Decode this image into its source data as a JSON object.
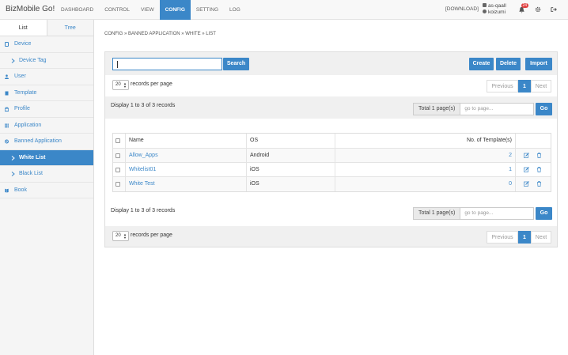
{
  "app": {
    "brand": "BizMobile Go!"
  },
  "nav": [
    "DASHBOARD",
    "CONTROL",
    "VIEW",
    "CONFIG",
    "SETTING",
    "LOG"
  ],
  "nav_active": "CONFIG",
  "header": {
    "download": "[DOWNLOAD]",
    "user_line1": "as-qaall",
    "user_line2": "koizumi",
    "notifications": "24"
  },
  "sidebar": {
    "tabs": [
      "List",
      "Tree"
    ],
    "items": [
      {
        "label": "Device"
      },
      {
        "label": "Device Tag"
      },
      {
        "label": "User"
      },
      {
        "label": "Template"
      },
      {
        "label": "Profile"
      },
      {
        "label": "Application"
      },
      {
        "label": "Banned Application"
      },
      {
        "label": "White List"
      },
      {
        "label": "Black List"
      },
      {
        "label": "Book"
      }
    ]
  },
  "breadcrumb": "CONFIG » BANNED APPLICATION » WHITE » LIST",
  "toolbar": {
    "search_value": "",
    "search_button": "Search",
    "create": "Create",
    "delete": "Delete",
    "import": "Import"
  },
  "paging": {
    "per_page_value": "20",
    "per_page_label": "records per page",
    "previous": "Previous",
    "current": "1",
    "next": "Next",
    "display": "Display 1 to 3 of 3 records",
    "total_pages": "Total 1 page(s)",
    "goto_placeholder": "go to page...",
    "go": "Go"
  },
  "table": {
    "headers": [
      "Name",
      "OS",
      "No. of Template(s)"
    ],
    "rows": [
      {
        "name": "Allow_Apps",
        "os": "Android",
        "count": "2"
      },
      {
        "name": "Whitelist01",
        "os": "iOS",
        "count": "1"
      },
      {
        "name": "White Test",
        "os": "iOS",
        "count": "0"
      }
    ]
  },
  "colors": {
    "accent": "#3b87c8",
    "badge": "#e04040"
  }
}
